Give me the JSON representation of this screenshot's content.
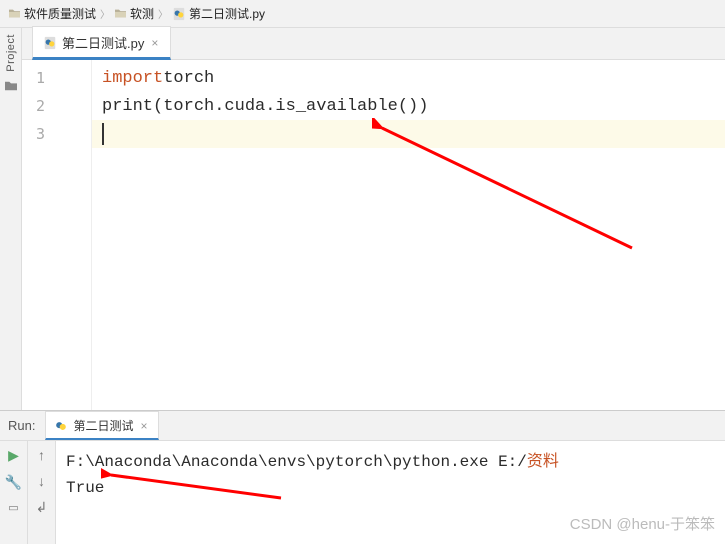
{
  "breadcrumb": {
    "root": "软件质量测试",
    "mid": "软测",
    "file": "第二日测试.py"
  },
  "sidebar": {
    "label": "Project"
  },
  "editor": {
    "tab": {
      "label": "第二日测试.py"
    },
    "lines": [
      "1",
      "2",
      "3"
    ],
    "code": {
      "l1_kw": "import",
      "l1_mod": " torch",
      "l2_fn": "print",
      "l2_open": "(",
      "l2_expr": "torch.cuda.is_available()",
      "l2_close": ")"
    }
  },
  "run": {
    "title": "Run:",
    "tab": {
      "label": "第二日测试"
    },
    "console": {
      "path_prefix": "F:\\Anaconda\\Anaconda\\envs\\pytorch\\python.exe E:/",
      "path_zh": "资料",
      "result": "True"
    }
  },
  "watermark": "CSDN @henu-于笨笨"
}
